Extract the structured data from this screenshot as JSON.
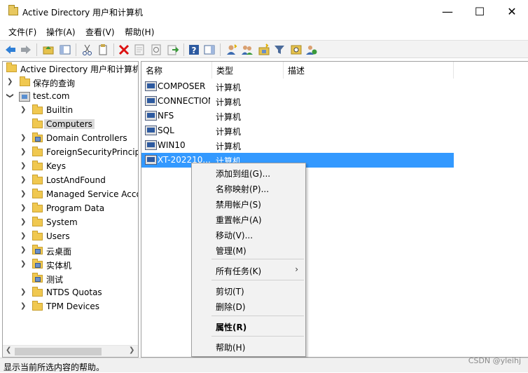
{
  "window": {
    "title": "Active Directory 用户和计算机",
    "minimize_glyph": "—",
    "maximize_glyph": "☐",
    "close_glyph": "✕"
  },
  "menubar": [
    "文件(F)",
    "操作(A)",
    "查看(V)",
    "帮助(H)"
  ],
  "toolbar": {
    "icons": [
      "back-arrow-icon",
      "forward-arrow-icon",
      "up-folder-icon",
      "console-tree-icon",
      "cut-icon",
      "copy-icon",
      "delete-icon",
      "properties-icon",
      "refresh-icon",
      "export-list-icon",
      "help-icon",
      "show-hide-action-pane-icon",
      "new-user-icon",
      "new-group-icon",
      "new-ou-icon",
      "filter-icon",
      "find-icon",
      "add-to-group-icon"
    ]
  },
  "tree": {
    "root": "Active Directory 用户和计算机",
    "saved_queries": "保存的查询",
    "domain": "test.com",
    "children": [
      "Builtin",
      "Computers",
      "Domain Controllers",
      "ForeignSecurityPrincipals",
      "Keys",
      "LostAndFound",
      "Managed Service Accounts",
      "Program Data",
      "System",
      "Users",
      "云桌面",
      "实体机",
      "测试",
      "NTDS Quotas",
      "TPM Devices"
    ],
    "selected": "Computers"
  },
  "list": {
    "columns": [
      "名称",
      "类型",
      "描述"
    ],
    "rows": [
      {
        "name": "COMPOSER",
        "type": "计算机"
      },
      {
        "name": "CONNECTION-SERVER",
        "type": "计算机"
      },
      {
        "name": "NFS",
        "type": "计算机"
      },
      {
        "name": "SQL",
        "type": "计算机"
      },
      {
        "name": "WIN10",
        "type": "计算机"
      },
      {
        "name": "XT-202210...",
        "type": "计算机"
      }
    ],
    "selected_index": 5
  },
  "context_menu": {
    "items": [
      "添加到组(G)...",
      "名称映射(P)...",
      "禁用帐户(S)",
      "重置帐户(A)",
      "移动(V)...",
      "管理(M)",
      "所有任务(K)",
      "剪切(T)",
      "删除(D)",
      "属性(R)",
      "帮助(H)"
    ],
    "submenu_arrow": "›"
  },
  "statusbar": {
    "text": "显示当前所选内容的帮助。"
  },
  "watermark": "CSDN @yleihj",
  "colors": {
    "selection": "#3399ff",
    "folder": "#f0c850",
    "tree_selected": "#d9d9d9"
  }
}
